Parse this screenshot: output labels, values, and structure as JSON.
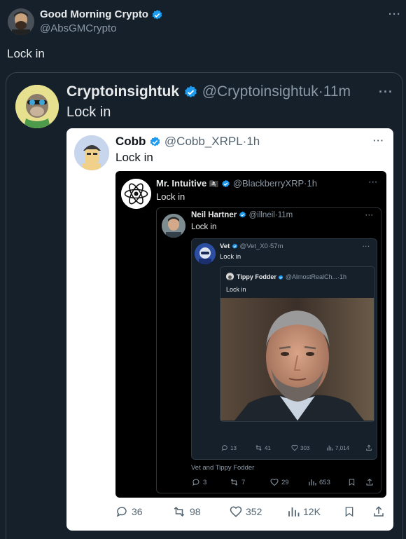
{
  "tweet": {
    "author_name": "Good Morning Crypto",
    "handle": "@AbsGMCrypto",
    "text": "Lock in"
  },
  "q1": {
    "author_name": "Cryptoinsightuk",
    "handle": "@Cryptoinsightuk",
    "dot": "·",
    "time": "11m",
    "text": "Lock in"
  },
  "q2": {
    "author_name": "Cobb",
    "handle": "@Cobb_XRPL",
    "dot": "·",
    "time": "1h",
    "text": "Lock in",
    "actions": {
      "replies": "36",
      "reposts": "98",
      "likes": "352",
      "views": "12K"
    }
  },
  "q3": {
    "author_name": "Mr. Intuitive",
    "flag": "🏴‍☠️",
    "handle": "@BlackberryXRP",
    "dot": "·",
    "time": "1h",
    "text": "Lock in",
    "footer": "Vet and Tippy Fodder",
    "actions": {
      "replies": "3",
      "reposts": "7",
      "likes": "29",
      "views": "653"
    }
  },
  "q4": {
    "author_name": "Neil Hartner",
    "handle": "@illneil",
    "dot": "·",
    "time": "11m",
    "text": "Lock in"
  },
  "q5": {
    "author_name": "Vet",
    "handle": "@Vet_X0",
    "dot": "·",
    "time": "57m",
    "text": "Lock in",
    "actions": {
      "replies": "13",
      "reposts": "41",
      "likes": "303",
      "views": "7,014"
    }
  },
  "q6": {
    "author_name": "Tippy Fodder",
    "handle": "@AlmostRealCh...",
    "dot": "·",
    "time": "1h",
    "text": "Lock in"
  },
  "icons": [
    "more-icon",
    "verified-icon",
    "reply-icon",
    "repost-icon",
    "like-icon",
    "views-icon",
    "bookmark-icon",
    "share-icon"
  ],
  "colors": {
    "background": "#15202b",
    "card": "#ffffff",
    "inner_dark": "#000000",
    "inner_card": "#15202b",
    "verified": "#1d9bf0",
    "muted": "#8b98a5"
  }
}
